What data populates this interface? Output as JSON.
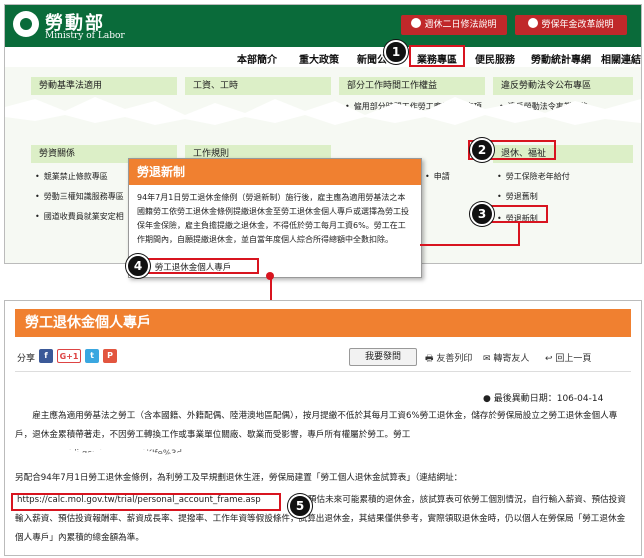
{
  "top": {
    "logo_title": "勞動部",
    "logo_subtitle": "Ministry of Labor",
    "top_button_1": "週休二日修法說明",
    "top_button_2": "勞保年金改革說明",
    "nav": [
      "本部簡介",
      "重大政策",
      "新聞公",
      "業務專區",
      "便民服務",
      "勞動統計專網",
      "相關連結"
    ],
    "categories_row1": [
      {
        "head": "勞動基準法適用",
        "item": ""
      },
      {
        "head": "工資、工時",
        "item": ""
      },
      {
        "head": "部分工作時間工作權益",
        "item": "僱用部分時間工作勞工應行注意事項"
      },
      {
        "head": "違反勞動法令公布專區",
        "item": "違反勞動法令事業單位"
      }
    ],
    "categories_row2": [
      {
        "head": "勞資關係",
        "items": [
          "競業禁止條款專區",
          "勞動三權知識服務專區",
          "國道收費員就業安定相"
        ]
      },
      {
        "head": "工作規則",
        "items": []
      },
      {
        "head": "退休、福祉",
        "items": [
          "勞工保險老年給付",
          "勞退舊制",
          "勞退新制"
        ]
      }
    ],
    "apply_text": "申請"
  },
  "popup": {
    "title": "勞退新制",
    "body": "94年7月1日勞工退休金條例（勞退新制）施行後，雇主應為適用勞基法之本國籍勞工依勞工退休金條例提繳退休金至勞工退休金個人專戶或選擇為勞工投保年金保險，雇主負擔提繳之退休金，不得低於勞工每月工資6%。勞工在工作期間內，自願提繳退休金，並自當年度個人綜合所得總額中全數扣除。",
    "link": "勞工退休金個人專戶"
  },
  "bottom": {
    "title": "勞工退休金個人專戶",
    "share_label": "分享",
    "share_icons": [
      "f",
      "G+1",
      "t",
      "P"
    ],
    "tools": {
      "feedback": "我要發問",
      "print": "友善列印",
      "forward": "轉寄友人",
      "back": "回上一頁"
    },
    "updated": "最後異動日期：106-04-14",
    "para1": "雇主應為適用勞基法之勞工（含本國籍、外籍配偶、陸港澳地區配偶），按月提繳不低於其每月工資6%勞工退休金，儲存於勞保局設立之勞工退休金個人專戶，退休金累積帶著走，不因勞工轉換工作或事業單位關廠、歇業而受影響，專戶所有權屬於勞工。勞工",
    "para1_tail": "https://www.bli.gov.tw/... sRVOKIfe%3d",
    "para2": "另配合94年7月1日勞工退休金條例，為利勞工及早規劃退休生涯，勞保局建置「勞工個人退休金試算表」（連結網址：",
    "url": "https://calc.mol.gov.tw/trial/personal_account_frame.asp",
    "para2_rest": "），預估未來可能累積的退休金，該試算表可依勞工個別情況，自行輸入薪資、預估投資報酬率、薪資成長率、提撥率、工作年資等假設條件，試算出退休金，其結果僅供參考，實際領取退休金時，仍以個人在勞保局「勞工退休金個人專戶」內累積的總金額為準。"
  },
  "badges": [
    "1",
    "2",
    "3",
    "4",
    "5"
  ],
  "colors": {
    "brand_green": "#0a6b3a",
    "orange": "#f08030",
    "highlight_red": "#d8141f"
  }
}
